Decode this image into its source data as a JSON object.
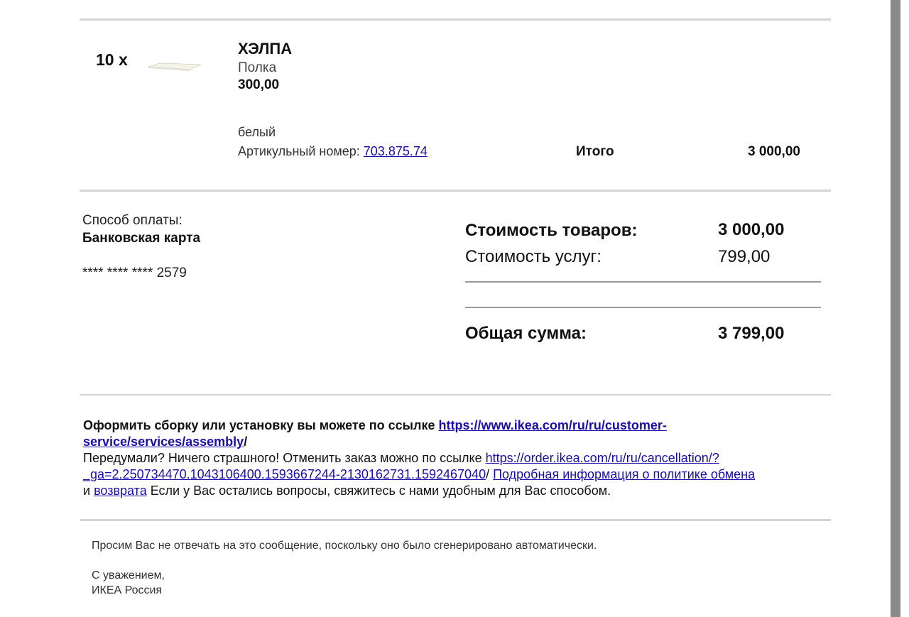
{
  "order_item": {
    "quantity": "10 x",
    "name": "ХЭЛПА",
    "type": "Полка",
    "price": "300,00",
    "color": "белый",
    "article_label": "Артикульный номер:",
    "article_number": "703.875.74",
    "total_label": "Итого",
    "total_value": "3 000,00"
  },
  "payment": {
    "method_label": "Способ оплаты:",
    "method_value": "Банковская карта",
    "card_mask": "**** **** **** 2579"
  },
  "summary": {
    "goods_label": "Стоимость товаров:",
    "goods_value": "3 000,00",
    "services_label": "Стоимость услуг:",
    "services_value": "799,00",
    "grand_total_label": "Общая сумма:",
    "grand_total_value": "3 799,00"
  },
  "info": {
    "assembly_text": "Оформить сборку или установку вы можете по ссылке ",
    "assembly_link_1": "https://www.ikea.com/ru/ru/customer-",
    "assembly_link_2": "service/services/assembly",
    "assembly_after": "/",
    "cancel_text": "Передумали? Ничего страшного! Отменить заказ можно по ссылке ",
    "cancel_link_1": "https://order.ikea.com/ru/ru/cancellation/?",
    "cancel_link_2": "_ga=2.250734470.1043106400.1593667244-2130162731.1592467040",
    "cancel_after": "/ ",
    "policy_link": "Подробная информация о политике обмена",
    "and_text": "и ",
    "return_link": "возврата",
    "questions_text": " Если у Вас остались вопросы, свяжитесь с нами удобным для Вас способом."
  },
  "footer": {
    "no_reply": "Просим Вас не отвечать на это сообщение, поскольку оно было сгенерировано автоматически.",
    "regards": "С уважением,",
    "signature": "ИКЕА Россия"
  },
  "icons": {
    "product_thumbnail": "shelf-thumbnail"
  }
}
